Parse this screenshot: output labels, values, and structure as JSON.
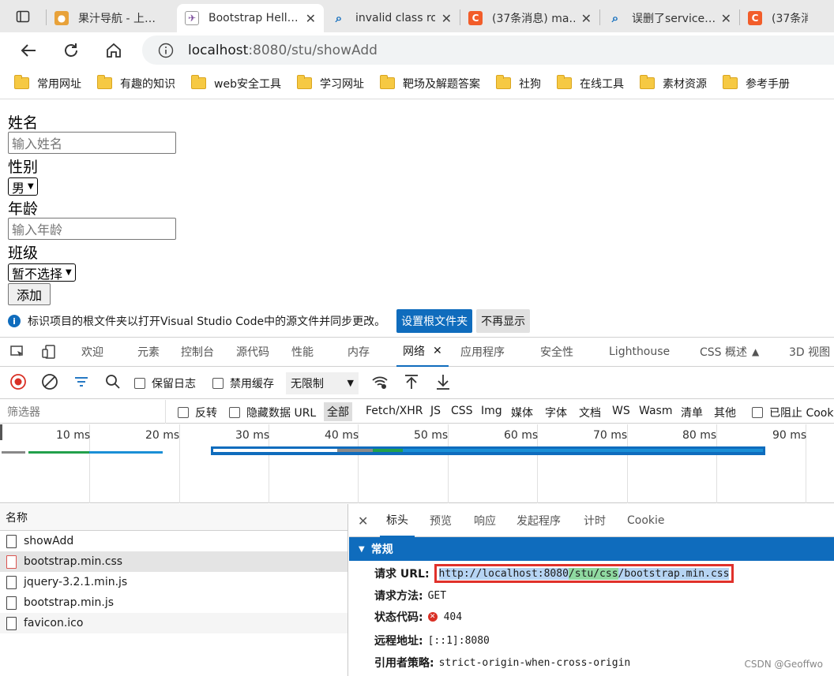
{
  "browser": {
    "tabs": [
      {
        "title": "果汁导航 - 上…",
        "favicon": "juice-icon"
      },
      {
        "title": "Bootstrap Hell…",
        "favicon": "bootstrap-icon",
        "active": true
      },
      {
        "title": "invalid class ro…",
        "favicon": "search-icon"
      },
      {
        "title": "(37条消息) ma…",
        "favicon": "csdn-icon"
      },
      {
        "title": "误删了service…",
        "favicon": "search-icon"
      },
      {
        "title": "(37条消息)",
        "favicon": "csdn-icon"
      }
    ],
    "address": {
      "host": "localhost",
      "path": ":8080/stu/showAdd"
    },
    "bookmarks": [
      "常用网址",
      "有趣的知识",
      "web安全工具",
      "学习网址",
      "靶场及解题答案",
      "社狗",
      "在线工具",
      "素材资源",
      "参考手册"
    ]
  },
  "form": {
    "name_label": "姓名",
    "name_placeholder": "输入姓名",
    "gender_label": "性别",
    "gender_value": "男",
    "age_label": "年龄",
    "age_placeholder": "输入年龄",
    "class_label": "班级",
    "class_value": "暂不选择",
    "add_button": "添加"
  },
  "infobar": {
    "message": "标识项目的根文件夹以打开Visual Studio Code中的源文件并同步更改。",
    "primary": "设置根文件夹",
    "secondary": "不再显示"
  },
  "devtools": {
    "tabs": [
      "欢迎",
      "元素",
      "控制台",
      "源代码",
      "性能",
      "内存",
      "网络",
      "应用程序",
      "安全性",
      "Lighthouse",
      "CSS 概述",
      "3D 视图"
    ],
    "network_toolbar": {
      "preserve_log": "保留日志",
      "disable_cache": "禁用缓存",
      "throttle": "无限制"
    },
    "filter": {
      "placeholder": "筛选器",
      "invert": "反转",
      "hide_data_url": "隐藏数据 URL",
      "all": "全部",
      "types": [
        "Fetch/XHR",
        "JS",
        "CSS",
        "Img",
        "媒体",
        "字体",
        "文档",
        "WS",
        "Wasm",
        "清单",
        "其他"
      ],
      "blocked": "已阻止 Cook"
    },
    "timeline_ticks": [
      "10 ms",
      "20 ms",
      "30 ms",
      "40 ms",
      "50 ms",
      "60 ms",
      "70 ms",
      "80 ms",
      "90 ms"
    ],
    "requests_header": "名称",
    "requests": [
      "showAdd",
      "bootstrap.min.css",
      "jquery-3.2.1.min.js",
      "bootstrap.min.js",
      "favicon.ico"
    ],
    "detail_tabs": [
      "标头",
      "预览",
      "响应",
      "发起程序",
      "计时",
      "Cookie"
    ],
    "general": {
      "title": "常规",
      "url_label": "请求 URL:",
      "url_a": "http://localhost:8080",
      "url_b": "/stu/css",
      "url_c": "/bootstrap.min.css",
      "method_label": "请求方法:",
      "method": "GET",
      "status_label": "状态代码:",
      "status": "404",
      "remote_label": "远程地址:",
      "remote": "[::1]:8080",
      "referrer_label": "引用者策略:",
      "referrer": "strict-origin-when-cross-origin"
    }
  },
  "watermark": "CSDN @Geoffwo"
}
